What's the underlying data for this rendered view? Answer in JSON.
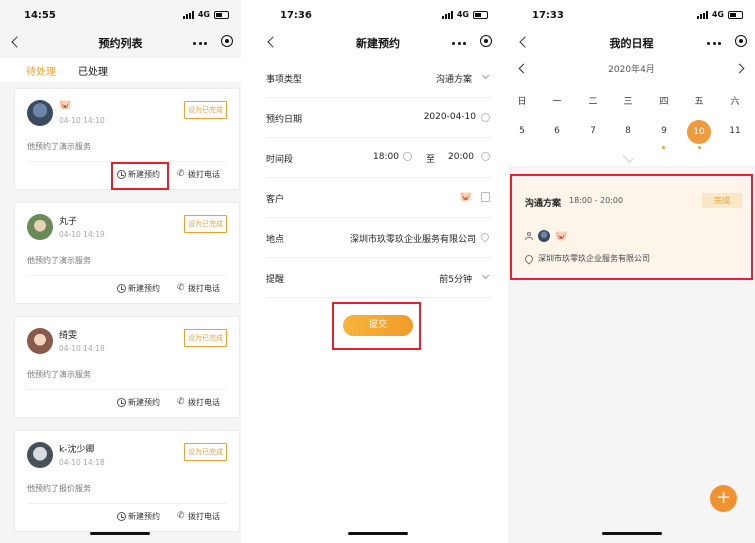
{
  "phone1": {
    "time": "14:55",
    "network": "4G",
    "title": "预约列表",
    "tabs": [
      "待处理",
      "已处理"
    ],
    "cards": [
      {
        "name": "🐷",
        "time": "04-10 14:10",
        "desc": "他预约了演示服务",
        "mark": "设为已完成",
        "action1": "新建预约",
        "action2": "拨打电话"
      },
      {
        "name": "丸子",
        "time": "04-10 14:19",
        "desc": "他预约了演示服务",
        "mark": "设为已完成",
        "action1": "新建预约",
        "action2": "拨打电话"
      },
      {
        "name": "绮雯",
        "time": "04-10 14:18",
        "desc": "他预约了演示服务",
        "mark": "设为已完成",
        "action1": "新建预约",
        "action2": "拨打电话"
      },
      {
        "name": "k-沈少卿",
        "time": "04-10 14:18",
        "desc": "他预约了报价服务",
        "mark": "设为已完成",
        "action1": "新建预约",
        "action2": "拨打电话"
      }
    ]
  },
  "phone2": {
    "time": "17:36",
    "network": "4G",
    "title": "新建预约",
    "rows": {
      "type_label": "事项类型",
      "type_value": "沟通方案",
      "date_label": "预约日期",
      "date_value": "2020-04-10",
      "period_label": "时间段",
      "start": "18:00",
      "to": "至",
      "end": "20:00",
      "customer_label": "客户",
      "customer_value": "🐷",
      "place_label": "地点",
      "place_value": "深圳市玖零玖企业服务有限公司",
      "remind_label": "提醒",
      "remind_value": "前5分钟"
    },
    "submit": "提交"
  },
  "phone3": {
    "time": "17:33",
    "network": "4G",
    "title": "我的日程",
    "month": "2020年4月",
    "weekdays": [
      "日",
      "一",
      "二",
      "三",
      "四",
      "五",
      "六"
    ],
    "days": [
      "5",
      "6",
      "7",
      "8",
      "9",
      "10",
      "11"
    ],
    "selected_day": "10",
    "event": {
      "title": "沟通方案",
      "time": "18:00 - 20:00",
      "status": "完成",
      "person": "🐷",
      "place": "深圳市玖零玖企业服务有限公司"
    },
    "fab": "+"
  },
  "colors": {
    "accent": "#f0a030",
    "highlight": "#e8202a"
  }
}
